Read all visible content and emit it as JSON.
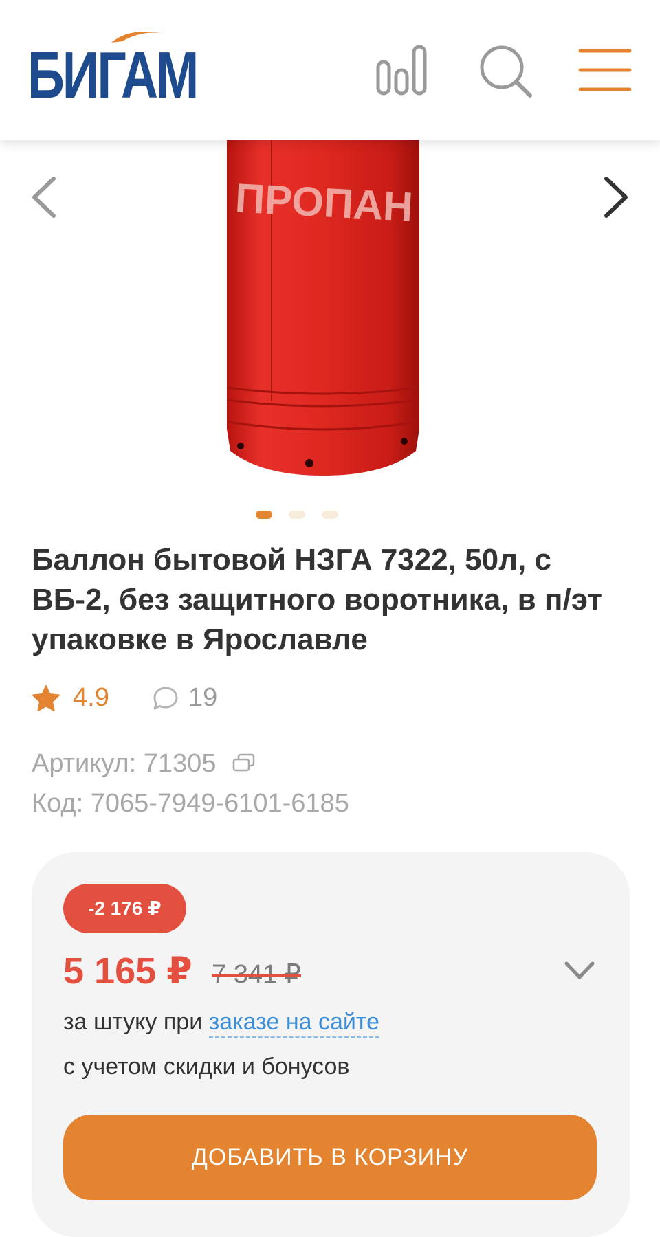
{
  "header": {
    "logo_text": "БИГАМ",
    "icons": [
      "compare-icon",
      "search-icon",
      "menu-icon"
    ],
    "colors": {
      "logo": "#1e4b8e",
      "accent": "#e58430",
      "icon": "#9a9a9a"
    }
  },
  "gallery": {
    "image_label": "ПРОПАН",
    "slide_count": 3,
    "active_slide": 1
  },
  "product": {
    "title": "Баллон бытовой НЗГА 7322, 50л, с ВБ-2, без защитного воротника, в п/эт упаковке в Ярославле",
    "rating": "4.9",
    "reviews": "19",
    "sku": "Артикул: 71305",
    "code": "Код: 7065-7949-6101-6185"
  },
  "price": {
    "discount": "-2 176 ₽",
    "current": "5 165 ₽",
    "old": "7 341 ₽",
    "per_unit_prefix": "за штуку при ",
    "per_unit_link": "заказе на сайте",
    "discount_note": "с учетом скидки и бонусов",
    "add_to_cart": "ДОБАВИТЬ В КОРЗИНУ",
    "colors": {
      "price": "#e4503f",
      "button": "#e58430",
      "link": "#3d8ed8"
    }
  }
}
